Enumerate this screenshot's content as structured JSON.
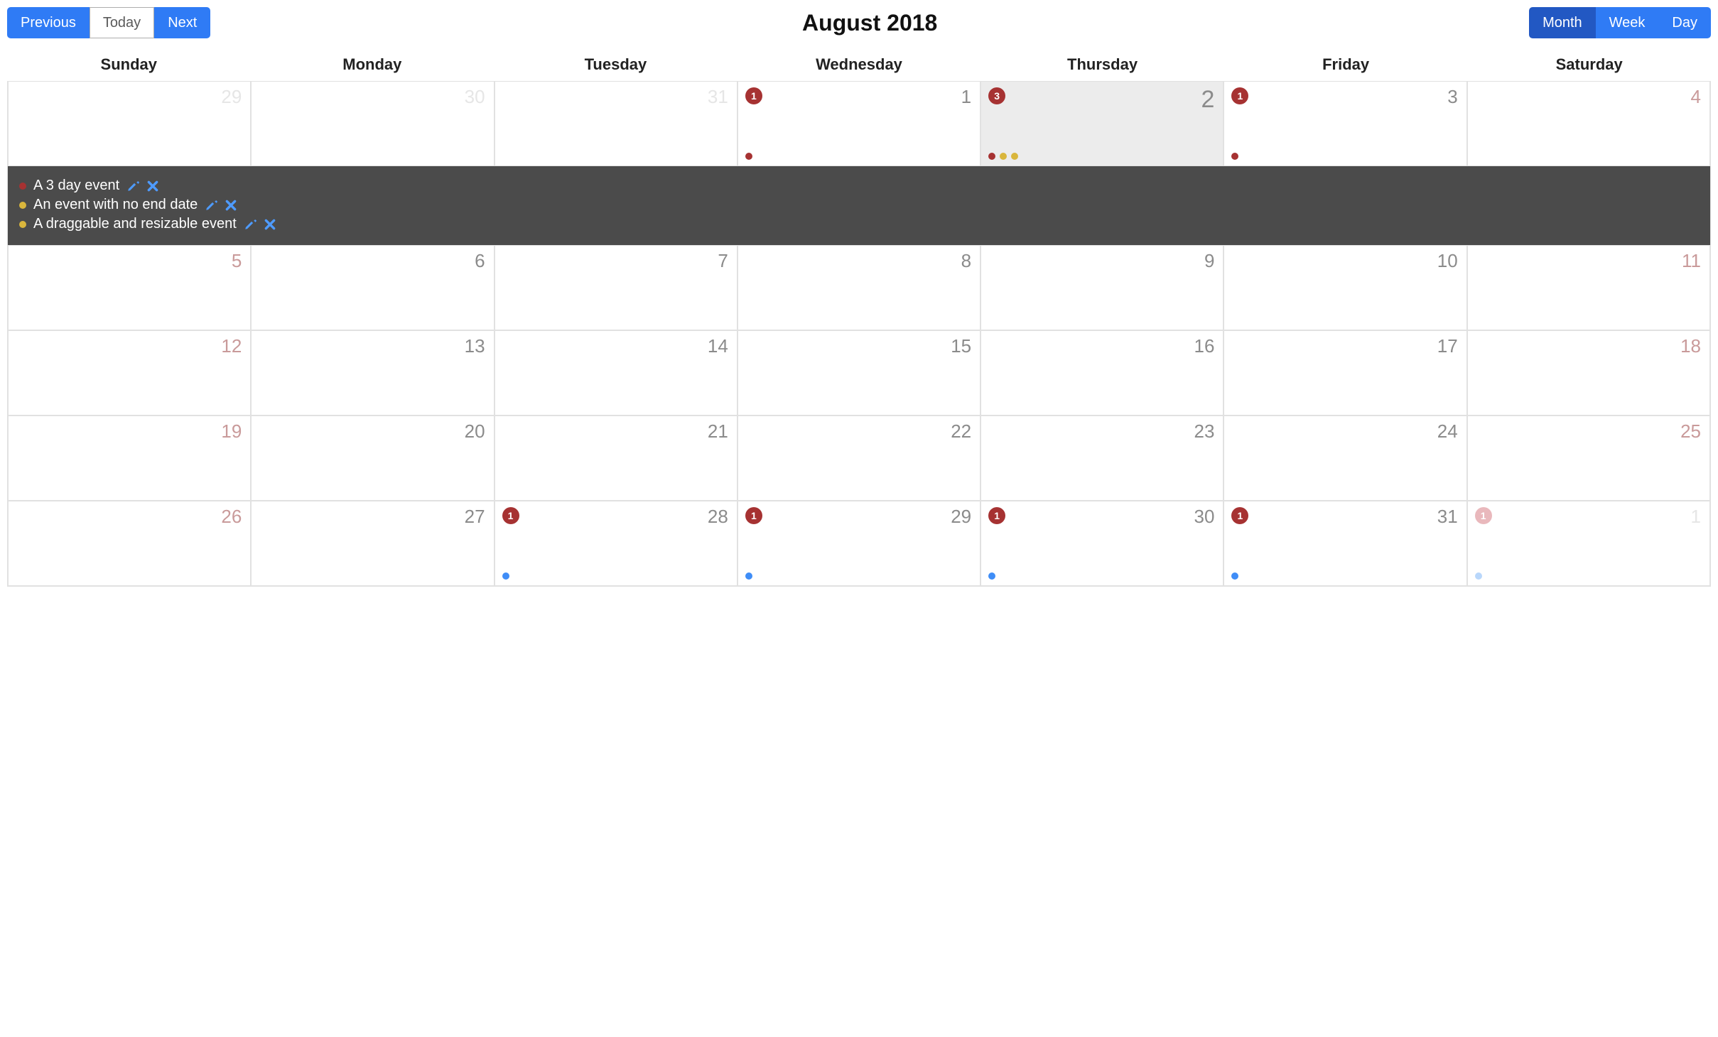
{
  "toolbar": {
    "prev_label": "Previous",
    "today_label": "Today",
    "next_label": "Next",
    "title": "August 2018",
    "views": {
      "month": "Month",
      "week": "Week",
      "day": "Day",
      "active": "month"
    }
  },
  "day_headers": [
    "Sunday",
    "Monday",
    "Tuesday",
    "Wednesday",
    "Thursday",
    "Friday",
    "Saturday"
  ],
  "weeks": [
    [
      {
        "num": "29",
        "out": true
      },
      {
        "num": "30",
        "out": true
      },
      {
        "num": "31",
        "out": true
      },
      {
        "num": "1",
        "badge": "1",
        "dots": [
          "red"
        ]
      },
      {
        "num": "2",
        "today": true,
        "badge": "3",
        "dots": [
          "red",
          "yellow",
          "yellow"
        ]
      },
      {
        "num": "3",
        "badge": "1",
        "dots": [
          "red"
        ]
      },
      {
        "num": "4",
        "weekend": true
      }
    ],
    [
      {
        "num": "5",
        "weekend": true
      },
      {
        "num": "6"
      },
      {
        "num": "7"
      },
      {
        "num": "8"
      },
      {
        "num": "9"
      },
      {
        "num": "10"
      },
      {
        "num": "11",
        "weekend": true
      }
    ],
    [
      {
        "num": "12",
        "weekend": true
      },
      {
        "num": "13"
      },
      {
        "num": "14"
      },
      {
        "num": "15"
      },
      {
        "num": "16"
      },
      {
        "num": "17"
      },
      {
        "num": "18",
        "weekend": true
      }
    ],
    [
      {
        "num": "19",
        "weekend": true
      },
      {
        "num": "20"
      },
      {
        "num": "21"
      },
      {
        "num": "22"
      },
      {
        "num": "23"
      },
      {
        "num": "24"
      },
      {
        "num": "25",
        "weekend": true
      }
    ],
    [
      {
        "num": "26",
        "weekend": true
      },
      {
        "num": "27"
      },
      {
        "num": "28",
        "badge": "1",
        "dots": [
          "blue"
        ]
      },
      {
        "num": "29",
        "badge": "1",
        "dots": [
          "blue"
        ]
      },
      {
        "num": "30",
        "badge": "1",
        "dots": [
          "blue"
        ]
      },
      {
        "num": "31",
        "badge": "1",
        "dots": [
          "blue"
        ]
      },
      {
        "num": "1",
        "out": true,
        "badge": "1",
        "badge_faded": true,
        "dots": [
          "lblue"
        ]
      }
    ]
  ],
  "open_day_events": [
    {
      "title": "A 3 day event",
      "color": "red"
    },
    {
      "title": "An event with no end date",
      "color": "yellow"
    },
    {
      "title": "A draggable and resizable event",
      "color": "yellow"
    }
  ]
}
